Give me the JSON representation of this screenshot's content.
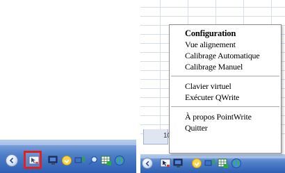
{
  "left_taskbar": {
    "tray_icons": [
      "back-arrow-icon",
      "pointwrite-tray-icon",
      "monitor-icon",
      "search-magnifier-icon",
      "speaker-icon",
      "network-icon",
      "spreadsheet-icon",
      "globe-icon"
    ],
    "highlight_color": "#e0211d"
  },
  "right_window": {
    "sheet_tab_label": "10",
    "menu": {
      "group1": [
        "Configuration",
        "Vue alignement",
        "Calibrage Automatique",
        "Calibrage Manuel"
      ],
      "group2": [
        "Clavier virtuel",
        "Exécuter QWrite"
      ],
      "group3": [
        "À propos PointWrite",
        "Quitter"
      ]
    },
    "tray_icons": [
      "back-arrow-icon",
      "pointwrite-tray-icon",
      "monitor-icon",
      "speaker-icon",
      "network-icon",
      "globe-icon"
    ]
  },
  "colors": {
    "taskbar_blue": "#4f7fc9",
    "menu_border": "#8a8a8a"
  }
}
